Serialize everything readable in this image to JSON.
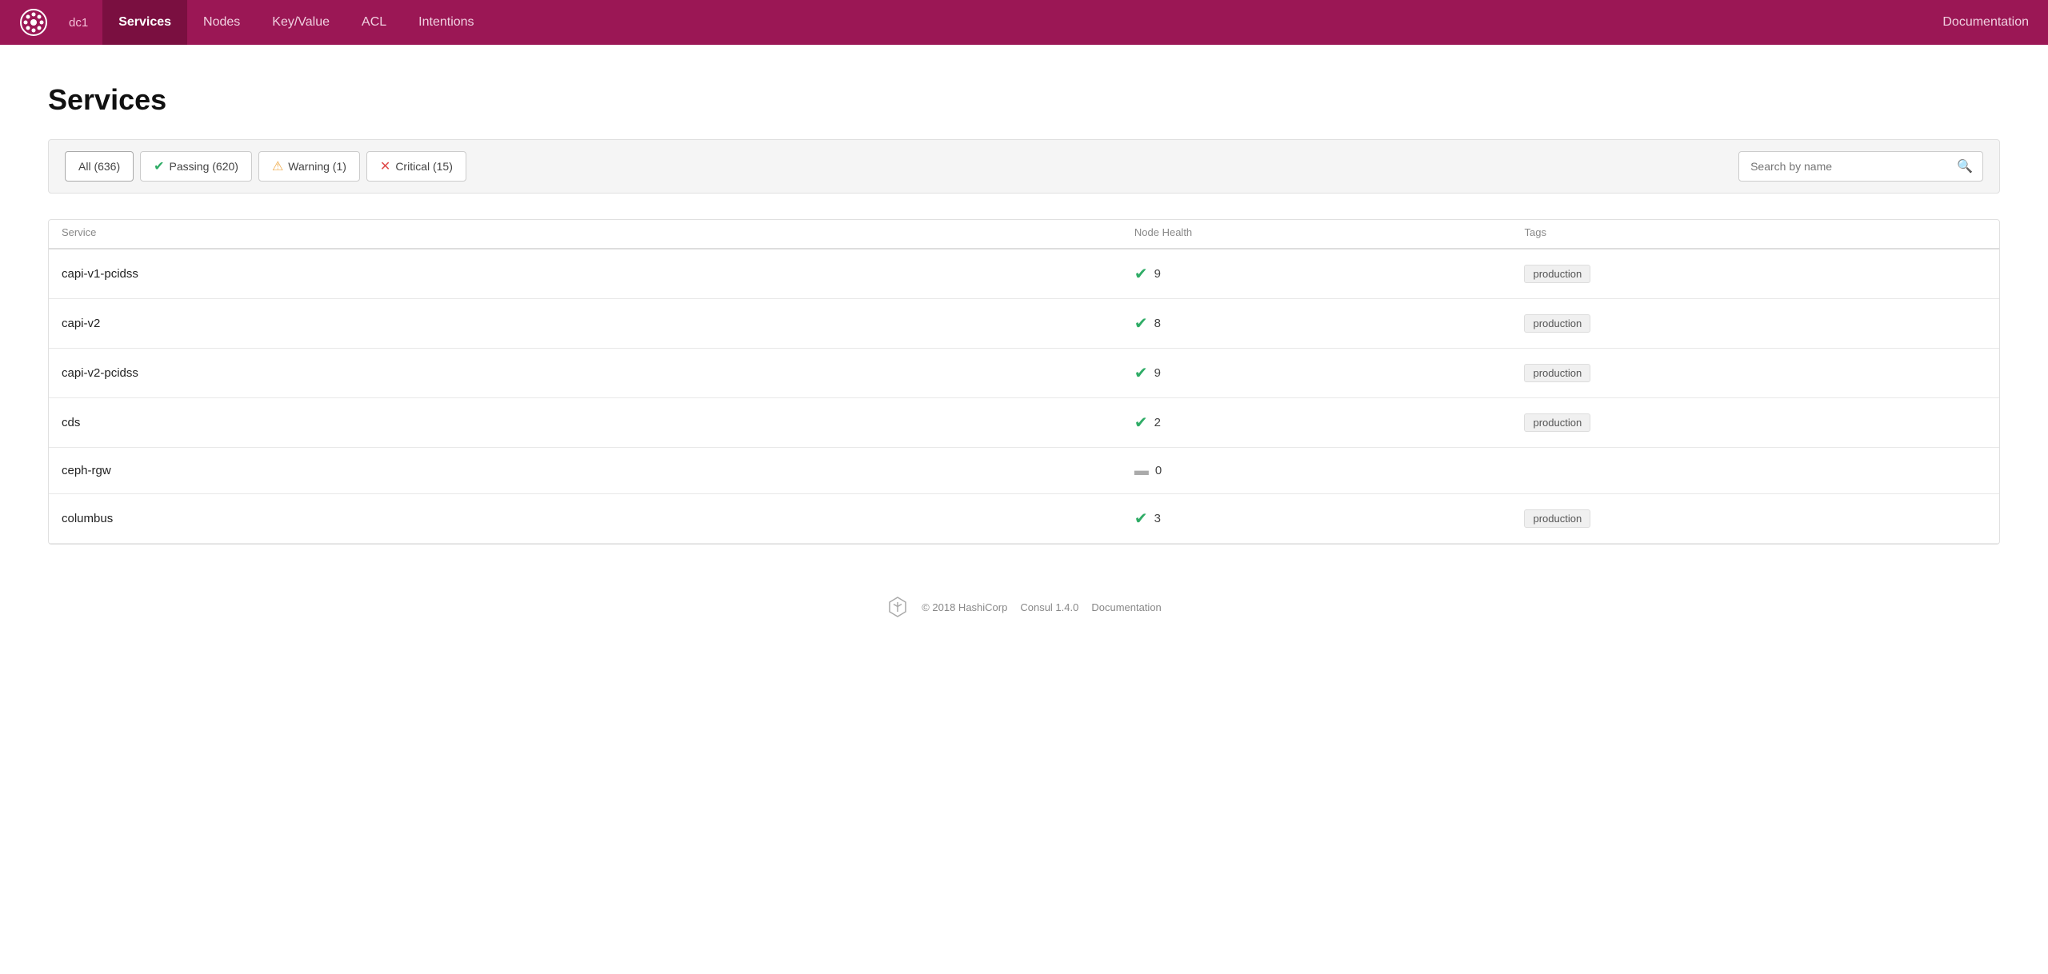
{
  "brand": {
    "logo_aria": "Consul logo",
    "dc_label": "dc1"
  },
  "nav": {
    "items": [
      {
        "label": "Services",
        "active": true
      },
      {
        "label": "Nodes",
        "active": false
      },
      {
        "label": "Key/Value",
        "active": false
      },
      {
        "label": "ACL",
        "active": false
      },
      {
        "label": "Intentions",
        "active": false
      }
    ],
    "docs_label": "Documentation"
  },
  "page": {
    "title": "Services"
  },
  "filters": {
    "all_label": "All (636)",
    "passing_label": "Passing (620)",
    "warning_label": "Warning (1)",
    "critical_label": "Critical (15)",
    "search_placeholder": "Search by name"
  },
  "table": {
    "columns": [
      "Service",
      "Node Health",
      "Tags"
    ],
    "rows": [
      {
        "name": "capi-v1-pcidss",
        "health_type": "passing",
        "health_count": "9",
        "tags": [
          "production"
        ]
      },
      {
        "name": "capi-v2",
        "health_type": "passing",
        "health_count": "8",
        "tags": [
          "production"
        ]
      },
      {
        "name": "capi-v2-pcidss",
        "health_type": "passing",
        "health_count": "9",
        "tags": [
          "production"
        ]
      },
      {
        "name": "cds",
        "health_type": "passing",
        "health_count": "2",
        "tags": [
          "production"
        ]
      },
      {
        "name": "ceph-rgw",
        "health_type": "unknown",
        "health_count": "0",
        "tags": []
      },
      {
        "name": "columbus",
        "health_type": "passing",
        "health_count": "3",
        "tags": [
          "production"
        ]
      }
    ]
  },
  "footer": {
    "copyright": "© 2018 HashiCorp",
    "version": "Consul 1.4.0",
    "docs_label": "Documentation"
  }
}
